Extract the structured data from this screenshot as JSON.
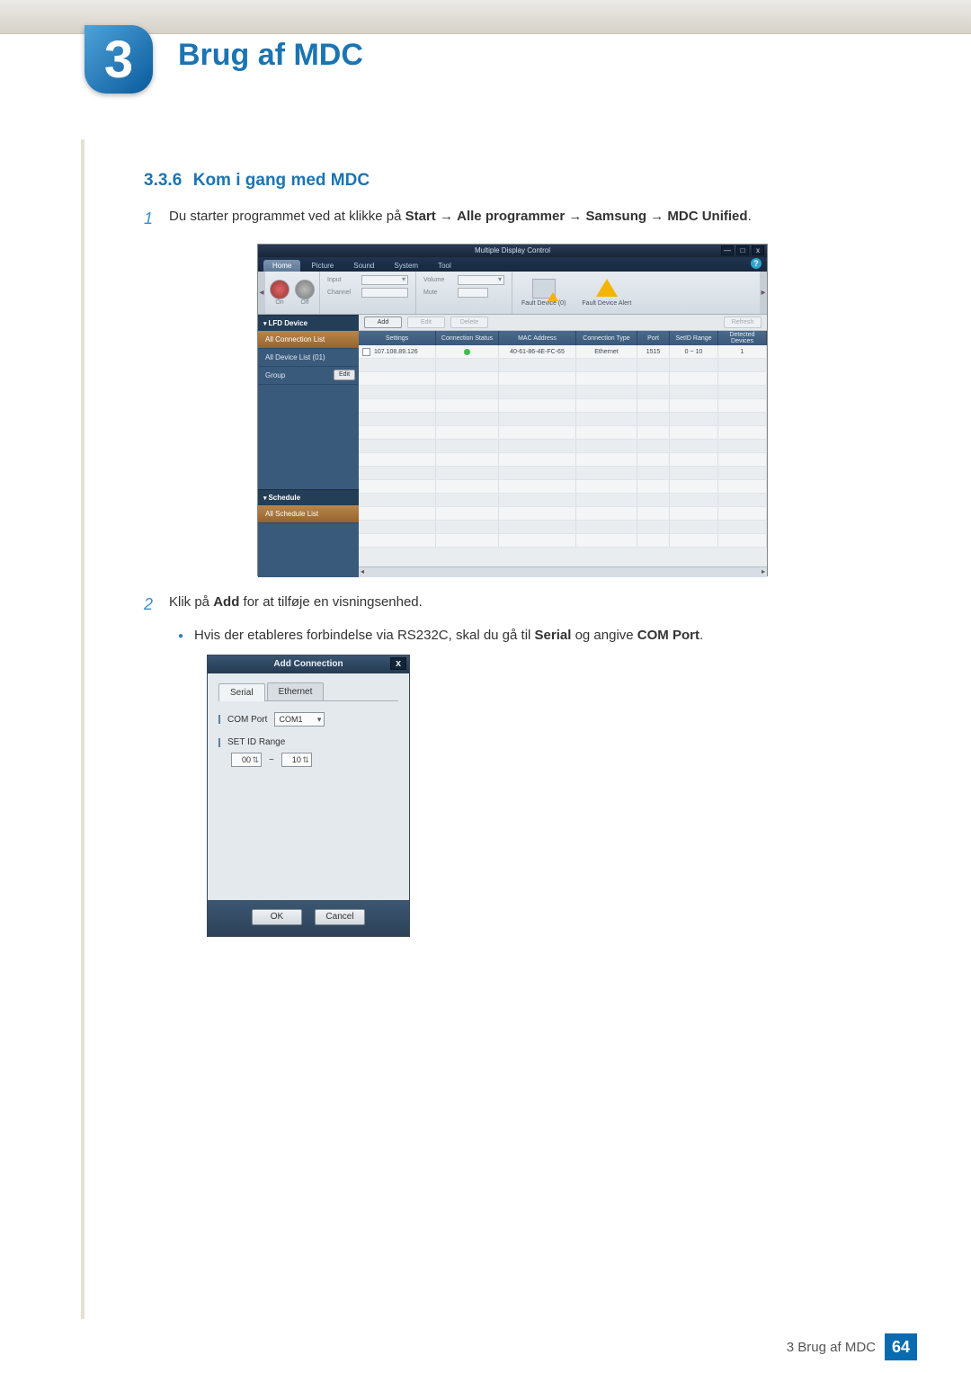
{
  "chapter": {
    "num": "3",
    "title": "Brug af MDC"
  },
  "section": {
    "num": "3.3.6",
    "title": "Kom i gang med MDC"
  },
  "steps": {
    "1": {
      "pre": "Du starter programmet ved at klikke på ",
      "bold1": "Start",
      "arrow": " → ",
      "bold2": "Alle programmer",
      "bold3": "Samsung",
      "bold4": "MDC Unified",
      "post": "."
    },
    "2": {
      "pre": "Klik på ",
      "bold": "Add",
      "post": " for at tilføje en visningsenhed."
    }
  },
  "bullet": {
    "pre": "Hvis der etableres forbindelse via RS232C, skal du gå til ",
    "bold1": "Serial",
    "mid": " og angive ",
    "bold2": "COM Port",
    "post": "."
  },
  "mdc": {
    "title": "Multiple Display Control",
    "win": {
      "min": "—",
      "max": "□",
      "close": "x"
    },
    "tabs": [
      "Home",
      "Picture",
      "Sound",
      "System",
      "Tool"
    ],
    "help": "?",
    "ribbon": {
      "on_lbl": "On",
      "off_lbl": "Off",
      "input_lbl": "Input",
      "channel_lbl": "Channel",
      "volume_lbl": "Volume",
      "mute_lbl": "Mute",
      "fault0": "Fault Device (0)",
      "alert": "Fault Device Alert"
    },
    "side": {
      "lfd": "LFD Device",
      "allconn": "All Connection List",
      "alldev": "All Device List (01)",
      "group": "Group",
      "edit": "Edit",
      "sched": "Schedule",
      "allsched": "All Schedule List"
    },
    "actions": {
      "add": "Add",
      "edit": "Edit",
      "delete": "Delete",
      "refresh": "Refresh"
    },
    "grid": {
      "headers": [
        "Settings",
        "Connection Status",
        "MAC Address",
        "Connection Type",
        "Port",
        "SetID Range",
        "Detected Devices"
      ],
      "row": {
        "settings": "107.108.89.126",
        "mac": "40-61-86-4E-FC-65",
        "conn": "Ethernet",
        "port": "1515",
        "range": "0 ~ 10",
        "detected": "1"
      }
    }
  },
  "dlg": {
    "title": "Add Connection",
    "close": "x",
    "tabs": {
      "serial": "Serial",
      "eth": "Ethernet"
    },
    "comport_lbl": "COM Port",
    "comport_val": "COM1",
    "setid_lbl": "SET ID Range",
    "range_from": "00",
    "range_sep": "~",
    "range_to": "10",
    "ok": "OK",
    "cancel": "Cancel"
  },
  "footer": {
    "label": "3 Brug af MDC",
    "page": "64"
  }
}
